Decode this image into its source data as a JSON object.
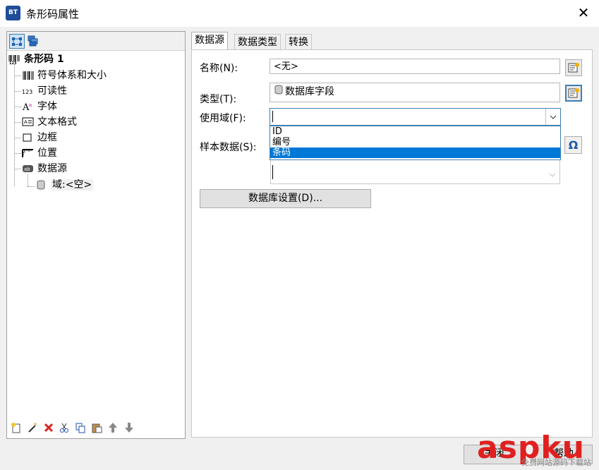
{
  "window": {
    "title": "条形码属性",
    "app_icon_text": "BT",
    "close_glyph": "✕"
  },
  "left": {
    "tree": {
      "root": "条形码 1",
      "items": [
        "符号体系和大小",
        "可读性",
        "字体",
        "文本格式",
        "边框",
        "位置",
        "数据源"
      ],
      "sub_item": "域:<空>"
    }
  },
  "tabs": [
    "数据源",
    "数据类型",
    "转换"
  ],
  "form": {
    "name_label": "名称(N):",
    "name_value": "<无>",
    "type_label": "类型(T):",
    "type_value": "数据库字段",
    "use_field_label": "使用域(F):",
    "use_field_value": "",
    "sample_label": "样本数据(S):",
    "dropdown_options": [
      "ID",
      "编号",
      "条码"
    ],
    "selected_option": "条码",
    "db_settings_button": "数据库设置(D)..."
  },
  "footer": {
    "close_button": "关闭",
    "help_button": "帮助"
  },
  "watermark": {
    "text": "aspku",
    "sub": "免费网站源码下载站"
  }
}
